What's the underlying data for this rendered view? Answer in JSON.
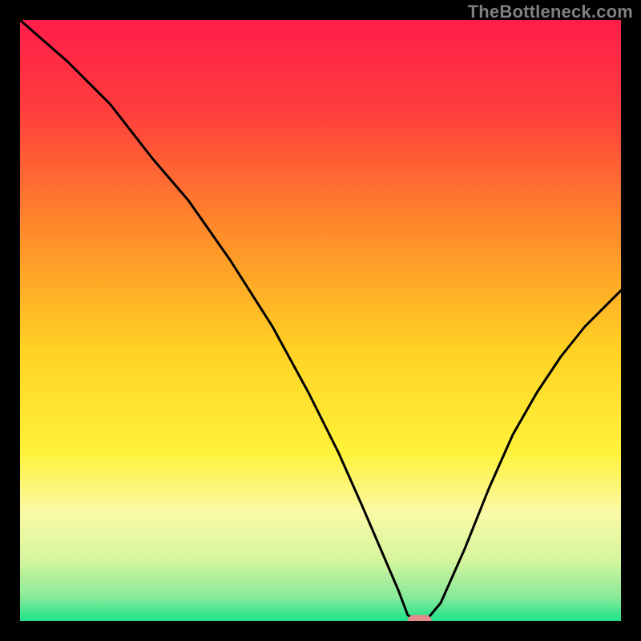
{
  "watermark": "TheBottleneck.com",
  "chart_data": {
    "type": "line",
    "title": "",
    "xlabel": "",
    "ylabel": "",
    "xlim": [
      0,
      100
    ],
    "ylim": [
      0,
      100
    ],
    "grid": false,
    "legend": false,
    "background_gradient_stops": [
      {
        "offset": 0.0,
        "color": "#ff1e4a"
      },
      {
        "offset": 0.15,
        "color": "#ff3d3d"
      },
      {
        "offset": 0.35,
        "color": "#ff8b2a"
      },
      {
        "offset": 0.55,
        "color": "#ffd224"
      },
      {
        "offset": 0.72,
        "color": "#fff23a"
      },
      {
        "offset": 0.82,
        "color": "#fbf9a7"
      },
      {
        "offset": 0.9,
        "color": "#d4f59c"
      },
      {
        "offset": 0.96,
        "color": "#88ea9a"
      },
      {
        "offset": 1.0,
        "color": "#1fe28b"
      }
    ],
    "series": [
      {
        "name": "bottleneck-curve",
        "color": "#000000",
        "x": [
          0,
          8,
          15,
          22,
          28,
          35,
          42,
          48,
          53,
          57,
          60,
          63,
          64.5,
          66,
          67.5,
          70,
          74,
          78,
          82,
          86,
          90,
          94,
          98,
          100
        ],
        "values": [
          100,
          93,
          86,
          77,
          70,
          60,
          49,
          38,
          28,
          19,
          12,
          5,
          1,
          0,
          0,
          3,
          12,
          22,
          31,
          38,
          44,
          49,
          53,
          55
        ]
      }
    ],
    "marker": {
      "name": "optimal-marker",
      "x": 66.5,
      "y": 0,
      "width_pct": 4,
      "height_pct": 2,
      "color": "#e38a8a"
    }
  }
}
